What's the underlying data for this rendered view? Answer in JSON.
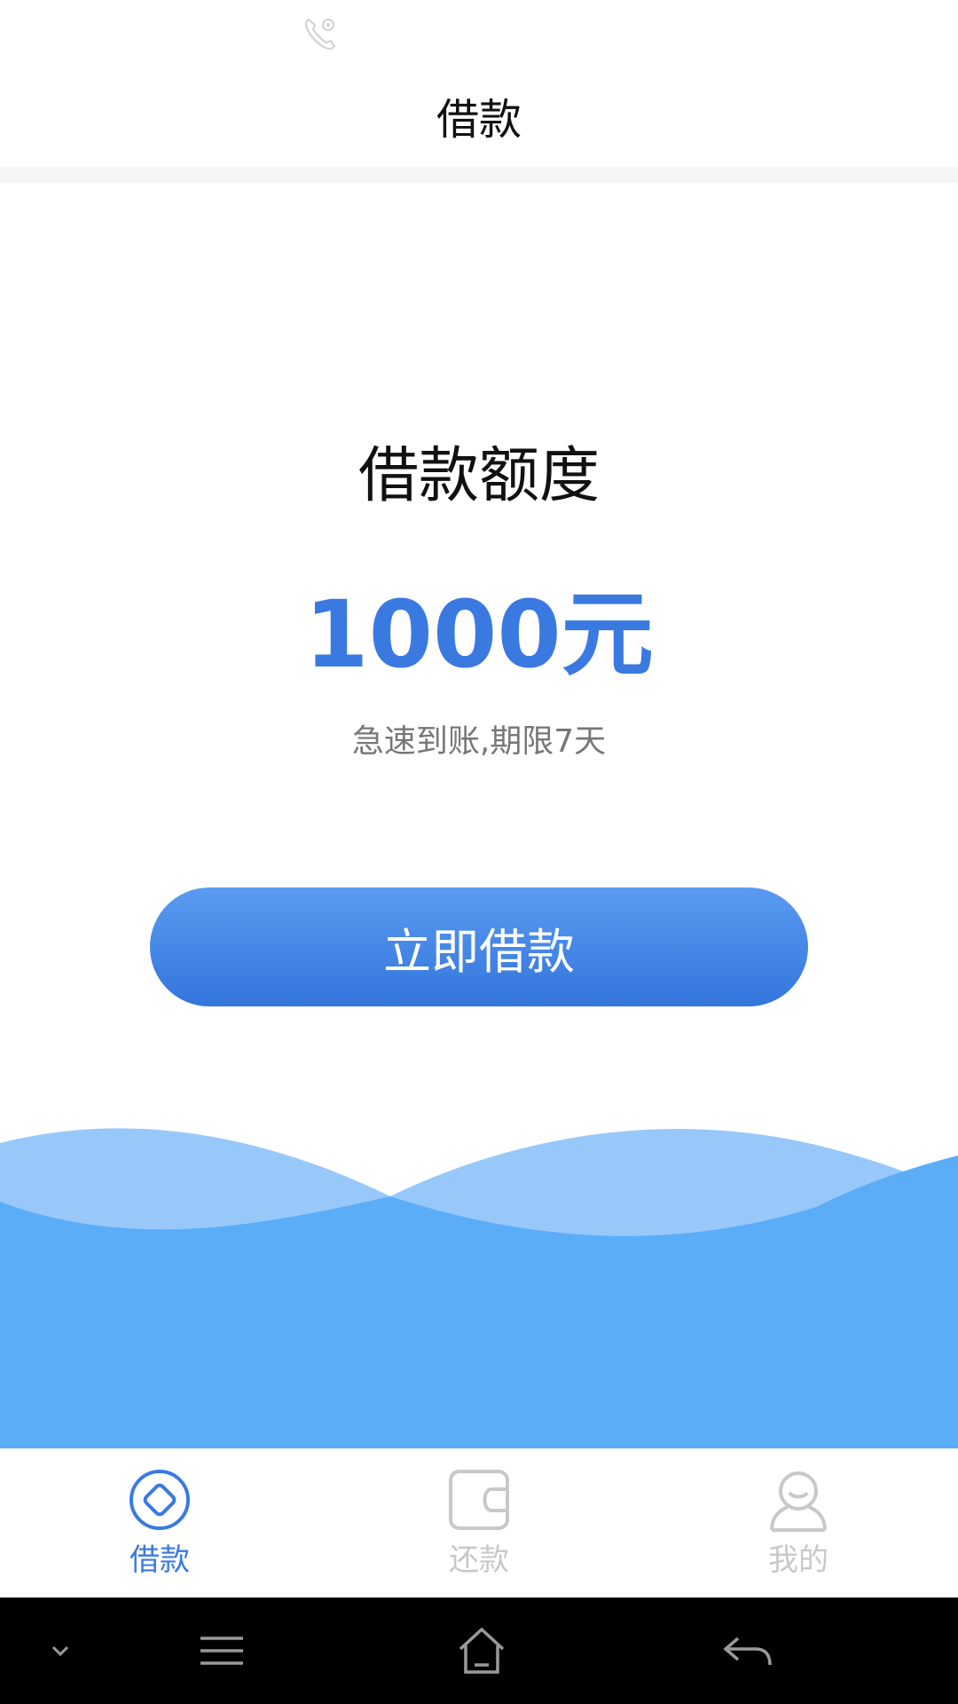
{
  "status_bar": {
    "call_icon": "phone-call-icon"
  },
  "header": {
    "title": "借款"
  },
  "main": {
    "quota_label": "借款额度",
    "quota_amount": "1000元",
    "quota_note": "急速到账,期限7天",
    "borrow_button_label": "立即借款"
  },
  "tabs": [
    {
      "label": "借款",
      "icon": "diamond-circle-icon",
      "active": true
    },
    {
      "label": "还款",
      "icon": "wallet-icon",
      "active": false
    },
    {
      "label": "我的",
      "icon": "user-icon",
      "active": false
    }
  ],
  "nav_bar": {
    "icons": [
      "chevron-down-icon",
      "menu-icon",
      "home-icon",
      "back-icon"
    ]
  },
  "colors": {
    "accent": "#3a7ae0",
    "wave_light": "#98c8fa",
    "wave_dark": "#5badf8",
    "tab_inactive": "#c8c8c8"
  }
}
